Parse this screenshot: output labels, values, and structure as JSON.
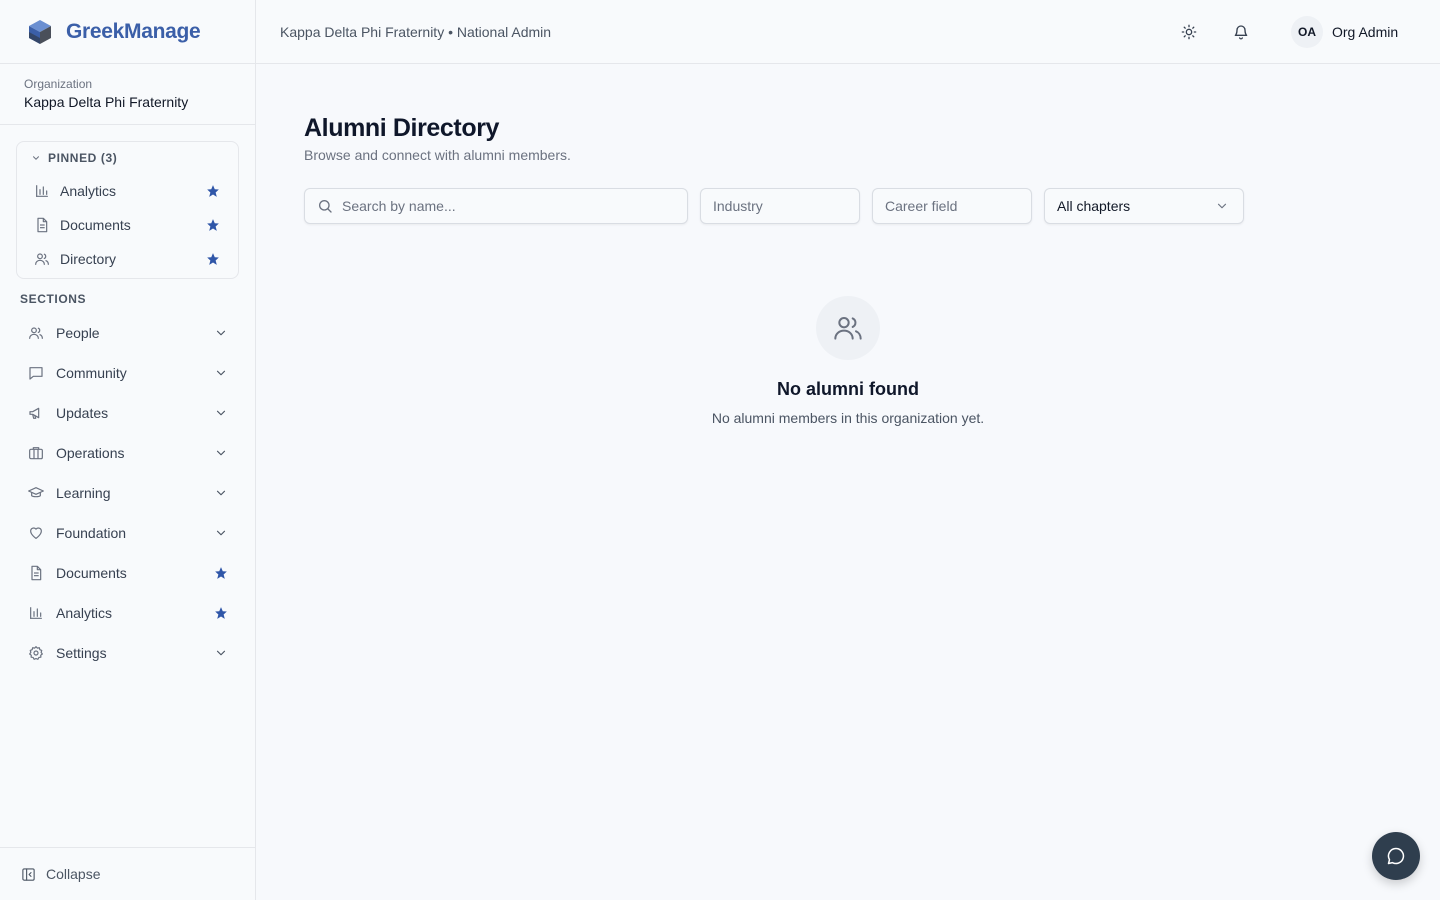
{
  "brand": {
    "name": "GreekManage"
  },
  "organization": {
    "label": "Organization",
    "name": "Kappa Delta Phi Fraternity"
  },
  "header": {
    "title": "Kappa Delta Phi Fraternity • National Admin",
    "user_initials": "OA",
    "user_name": "Org Admin"
  },
  "pinned": {
    "label": "PINNED (3)",
    "items": [
      {
        "label": "Analytics",
        "icon": "bar-chart-icon"
      },
      {
        "label": "Documents",
        "icon": "document-icon"
      },
      {
        "label": "Directory",
        "icon": "users-icon"
      }
    ]
  },
  "sections": {
    "label": "SECTIONS",
    "items": [
      {
        "label": "People",
        "icon": "users-icon",
        "trailing": "chevron"
      },
      {
        "label": "Community",
        "icon": "message-icon",
        "trailing": "chevron"
      },
      {
        "label": "Updates",
        "icon": "megaphone-icon",
        "trailing": "chevron"
      },
      {
        "label": "Operations",
        "icon": "briefcase-icon",
        "trailing": "chevron"
      },
      {
        "label": "Learning",
        "icon": "graduation-cap-icon",
        "trailing": "chevron"
      },
      {
        "label": "Foundation",
        "icon": "heart-icon",
        "trailing": "chevron"
      },
      {
        "label": "Documents",
        "icon": "document-icon",
        "trailing": "star"
      },
      {
        "label": "Analytics",
        "icon": "bar-chart-icon",
        "trailing": "star"
      },
      {
        "label": "Settings",
        "icon": "gear-icon",
        "trailing": "chevron"
      }
    ]
  },
  "sidebar_footer": {
    "collapse_label": "Collapse"
  },
  "page": {
    "title": "Alumni Directory",
    "subtitle": "Browse and connect with alumni members."
  },
  "filters": {
    "search_placeholder": "Search by name...",
    "industry_placeholder": "Industry",
    "career_placeholder": "Career field",
    "chapter_selected": "All chapters"
  },
  "empty_state": {
    "title": "No alumni found",
    "text": "No alumni members in this organization yet."
  },
  "colors": {
    "brand": "#3b5fa8",
    "star": "#2f56a8",
    "fab": "#2f3e4e"
  }
}
